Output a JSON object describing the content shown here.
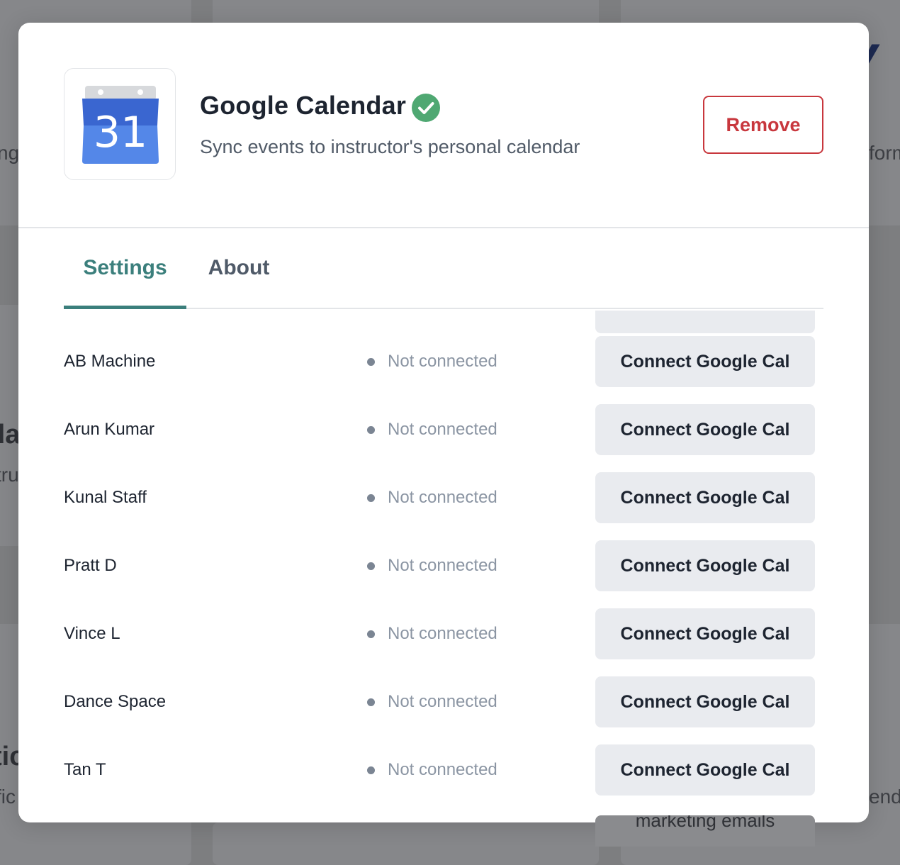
{
  "background": {
    "frag_ng": "ng",
    "frag_form": "form",
    "frag_da": "da",
    "frag_tru": "tru",
    "frag_tic": "tic",
    "frag_fic": "fic",
    "frag_end": "end",
    "frag_marketing": "marketing emails"
  },
  "modal": {
    "app": {
      "icon": "google-calendar-icon",
      "icon_day": "31",
      "title": "Google Calendar",
      "verified_icon": "check-circle-icon",
      "subtitle": "Sync events to instructor's personal calendar",
      "remove_label": "Remove"
    },
    "tabs": [
      {
        "label": "Settings",
        "active": true
      },
      {
        "label": "About",
        "active": false
      }
    ],
    "instructors": [
      {
        "name": "AB Machine",
        "status": "Not connected",
        "action": "Connect Google Cal"
      },
      {
        "name": "Arun Kumar",
        "status": "Not connected",
        "action": "Connect Google Cal"
      },
      {
        "name": "Kunal Staff",
        "status": "Not connected",
        "action": "Connect Google Cal"
      },
      {
        "name": "Pratt D",
        "status": "Not connected",
        "action": "Connect Google Cal"
      },
      {
        "name": "Vince L",
        "status": "Not connected",
        "action": "Connect Google Cal"
      },
      {
        "name": "Dance Space",
        "status": "Not connected",
        "action": "Connect Google Cal"
      },
      {
        "name": "Tan T",
        "status": "Not connected",
        "action": "Connect Google Cal"
      }
    ]
  },
  "colors": {
    "accent": "#3b7f7c",
    "danger": "#c8373d",
    "success": "#4fa872",
    "google_blue": "#4a7de0"
  }
}
